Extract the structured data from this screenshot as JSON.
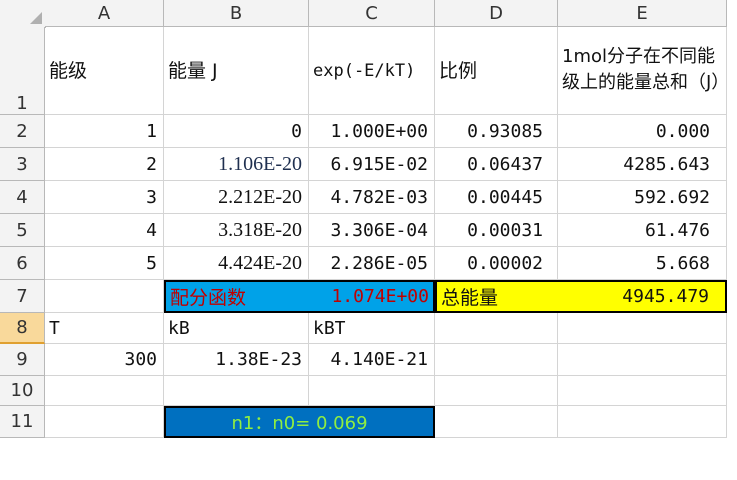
{
  "columns": [
    "A",
    "B",
    "C",
    "D",
    "E"
  ],
  "row_numbers": [
    "1",
    "2",
    "3",
    "4",
    "5",
    "6",
    "7",
    "8",
    "9",
    "10",
    "11"
  ],
  "header_row": {
    "a": "能级",
    "b": "能量 J",
    "c": "exp(-E/kT)",
    "d": "比例",
    "e": "1mol分子在不同能级上的能量总和（J）"
  },
  "rows": [
    {
      "a": "1",
      "b": "0",
      "c": "1.000E+00",
      "d": "0.93085",
      "e": "0.000"
    },
    {
      "a": "2",
      "b": "1.106E-20",
      "c": "6.915E-02",
      "d": "0.06437",
      "e": "4285.643"
    },
    {
      "a": "3",
      "b": "2.212E-20",
      "c": "4.782E-03",
      "d": "0.00445",
      "e": "592.692"
    },
    {
      "a": "4",
      "b": "3.318E-20",
      "c": "3.306E-04",
      "d": "0.00031",
      "e": "61.476"
    },
    {
      "a": "5",
      "b": "4.424E-20",
      "c": "2.286E-05",
      "d": "0.00002",
      "e": "5.668"
    }
  ],
  "summary": {
    "partition_label": "配分函数",
    "partition_value": "1.074E+00",
    "total_label": "总能量",
    "total_value": "4945.479"
  },
  "constants_labels": {
    "a": "T",
    "b": "kB",
    "c": "kBT"
  },
  "constants_values": {
    "a": "300",
    "b": "1.38E-23",
    "c": "4.140E-21"
  },
  "ratio_text": "n1：n0= 0.069",
  "colors": {
    "blue": "#00a2e8",
    "yellow": "#ffff00",
    "dark_blue": "#0070c0",
    "red": "#c00000",
    "green": "#90ee40"
  }
}
